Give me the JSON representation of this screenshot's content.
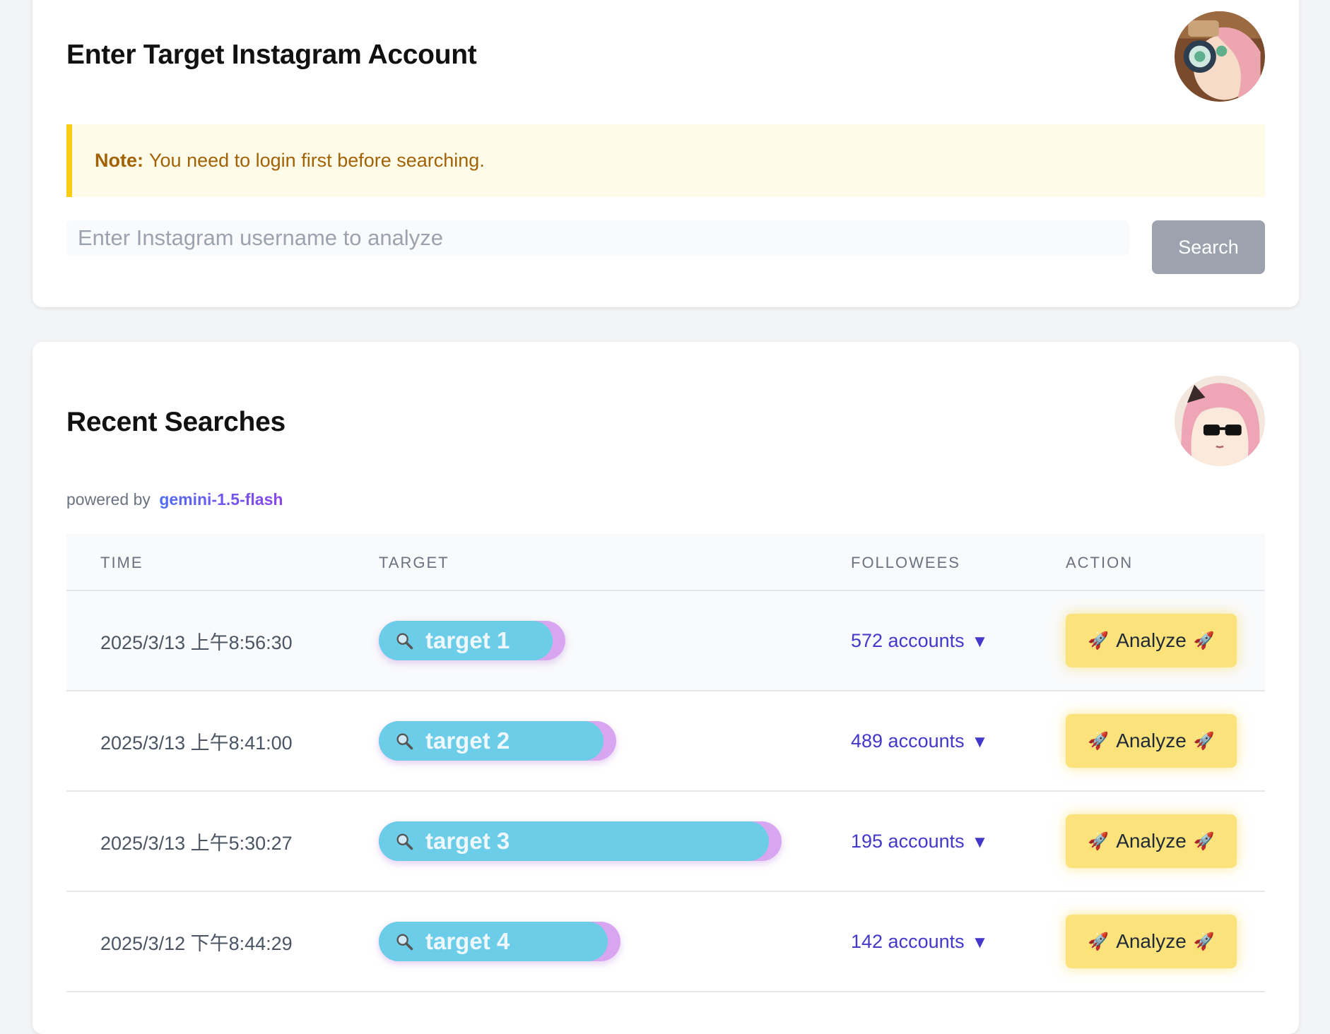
{
  "search_card": {
    "title": "Enter Target Instagram Account",
    "note_label": "Note:",
    "note_text": "You need to login first before searching.",
    "input_placeholder": "Enter Instagram username to analyze",
    "input_value": "",
    "search_label": "Search"
  },
  "recent_card": {
    "title": "Recent Searches",
    "powered_by": "powered by",
    "model": "gemini-1.5-flash",
    "columns": [
      "TIME",
      "TARGET",
      "FOLLOWEES",
      "ACTION"
    ],
    "rows": [
      {
        "time": "2025/3/13 上午8:56:30",
        "target": "target 1",
        "followees": "572 accounts",
        "caret": "▼",
        "action": "Analyze",
        "rocket": "🚀"
      },
      {
        "time": "2025/3/13 上午8:41:00",
        "target": "target 2",
        "followees": "489 accounts",
        "caret": "▼",
        "action": "Analyze",
        "rocket": "🚀"
      },
      {
        "time": "2025/3/13 上午5:30:27",
        "target": "target 3",
        "followees": "195 accounts",
        "caret": "▼",
        "action": "Analyze",
        "rocket": "🚀"
      },
      {
        "time": "2025/3/12 下午8:44:29",
        "target": "target 4",
        "followees": "142 accounts",
        "caret": "▼",
        "action": "Analyze",
        "rocket": "🚀"
      }
    ]
  },
  "colors": {
    "note_bg": "#fefce8",
    "note_border": "#facc15",
    "link": "#4338ca",
    "pill": "#6ccde9",
    "pill_edge": "#d8a6f0",
    "analyze_bg": "#fbe27a"
  },
  "icons": [
    "avatar-detective-icon",
    "avatar-sunglasses-icon",
    "magnifier-icon",
    "rocket-icon",
    "caret-down-icon"
  ]
}
